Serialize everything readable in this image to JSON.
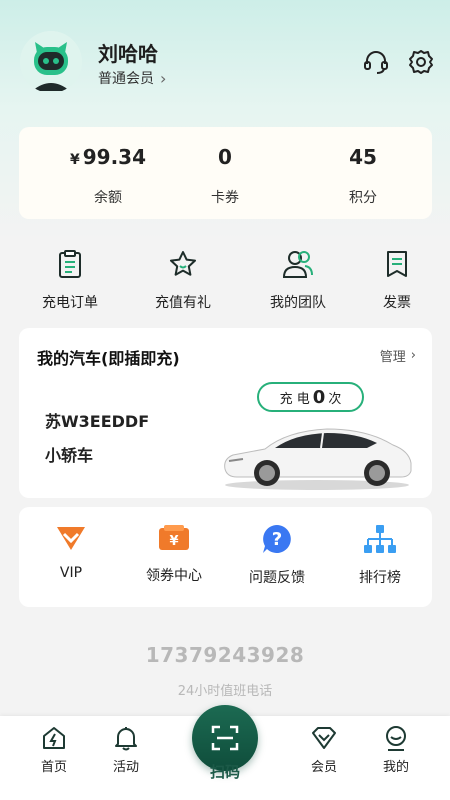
{
  "user": {
    "name": "刘哈哈",
    "membership": "普通会员"
  },
  "stats": {
    "balance": {
      "currency": "¥",
      "value": "99.34",
      "label": "余额"
    },
    "coupons": {
      "value": "0",
      "label": "卡券"
    },
    "points": {
      "value": "45",
      "label": "积分"
    }
  },
  "quick_actions": [
    {
      "label": "充电订单",
      "icon": "clipboard-icon"
    },
    {
      "label": "充值有礼",
      "icon": "star-icon"
    },
    {
      "label": "我的团队",
      "icon": "team-icon"
    },
    {
      "label": "发票",
      "icon": "invoice-icon"
    }
  ],
  "car": {
    "section_title": "我的汽车(即插即充)",
    "manage_label": "管理",
    "charge_prefix": "充 电",
    "charge_count": "0",
    "charge_suffix": "次",
    "plate": "苏W3EEDDF",
    "type": "小轿车"
  },
  "services": [
    {
      "label": "VIP",
      "icon": "vip-icon"
    },
    {
      "label": "领券中心",
      "icon": "coupon-center-icon"
    },
    {
      "label": "问题反馈",
      "icon": "feedback-icon"
    },
    {
      "label": "排行榜",
      "icon": "ranking-icon"
    }
  ],
  "hotline": {
    "number": "17379243928",
    "label": "24小时值班电话"
  },
  "tabbar": {
    "home": "首页",
    "activity": "活动",
    "scan": "扫码",
    "member": "会员",
    "mine": "我的"
  },
  "colors": {
    "brand_green": "#1c6a52",
    "accent_green": "#27b07a",
    "orange": "#f07a2a",
    "blue": "#3a78f2"
  }
}
